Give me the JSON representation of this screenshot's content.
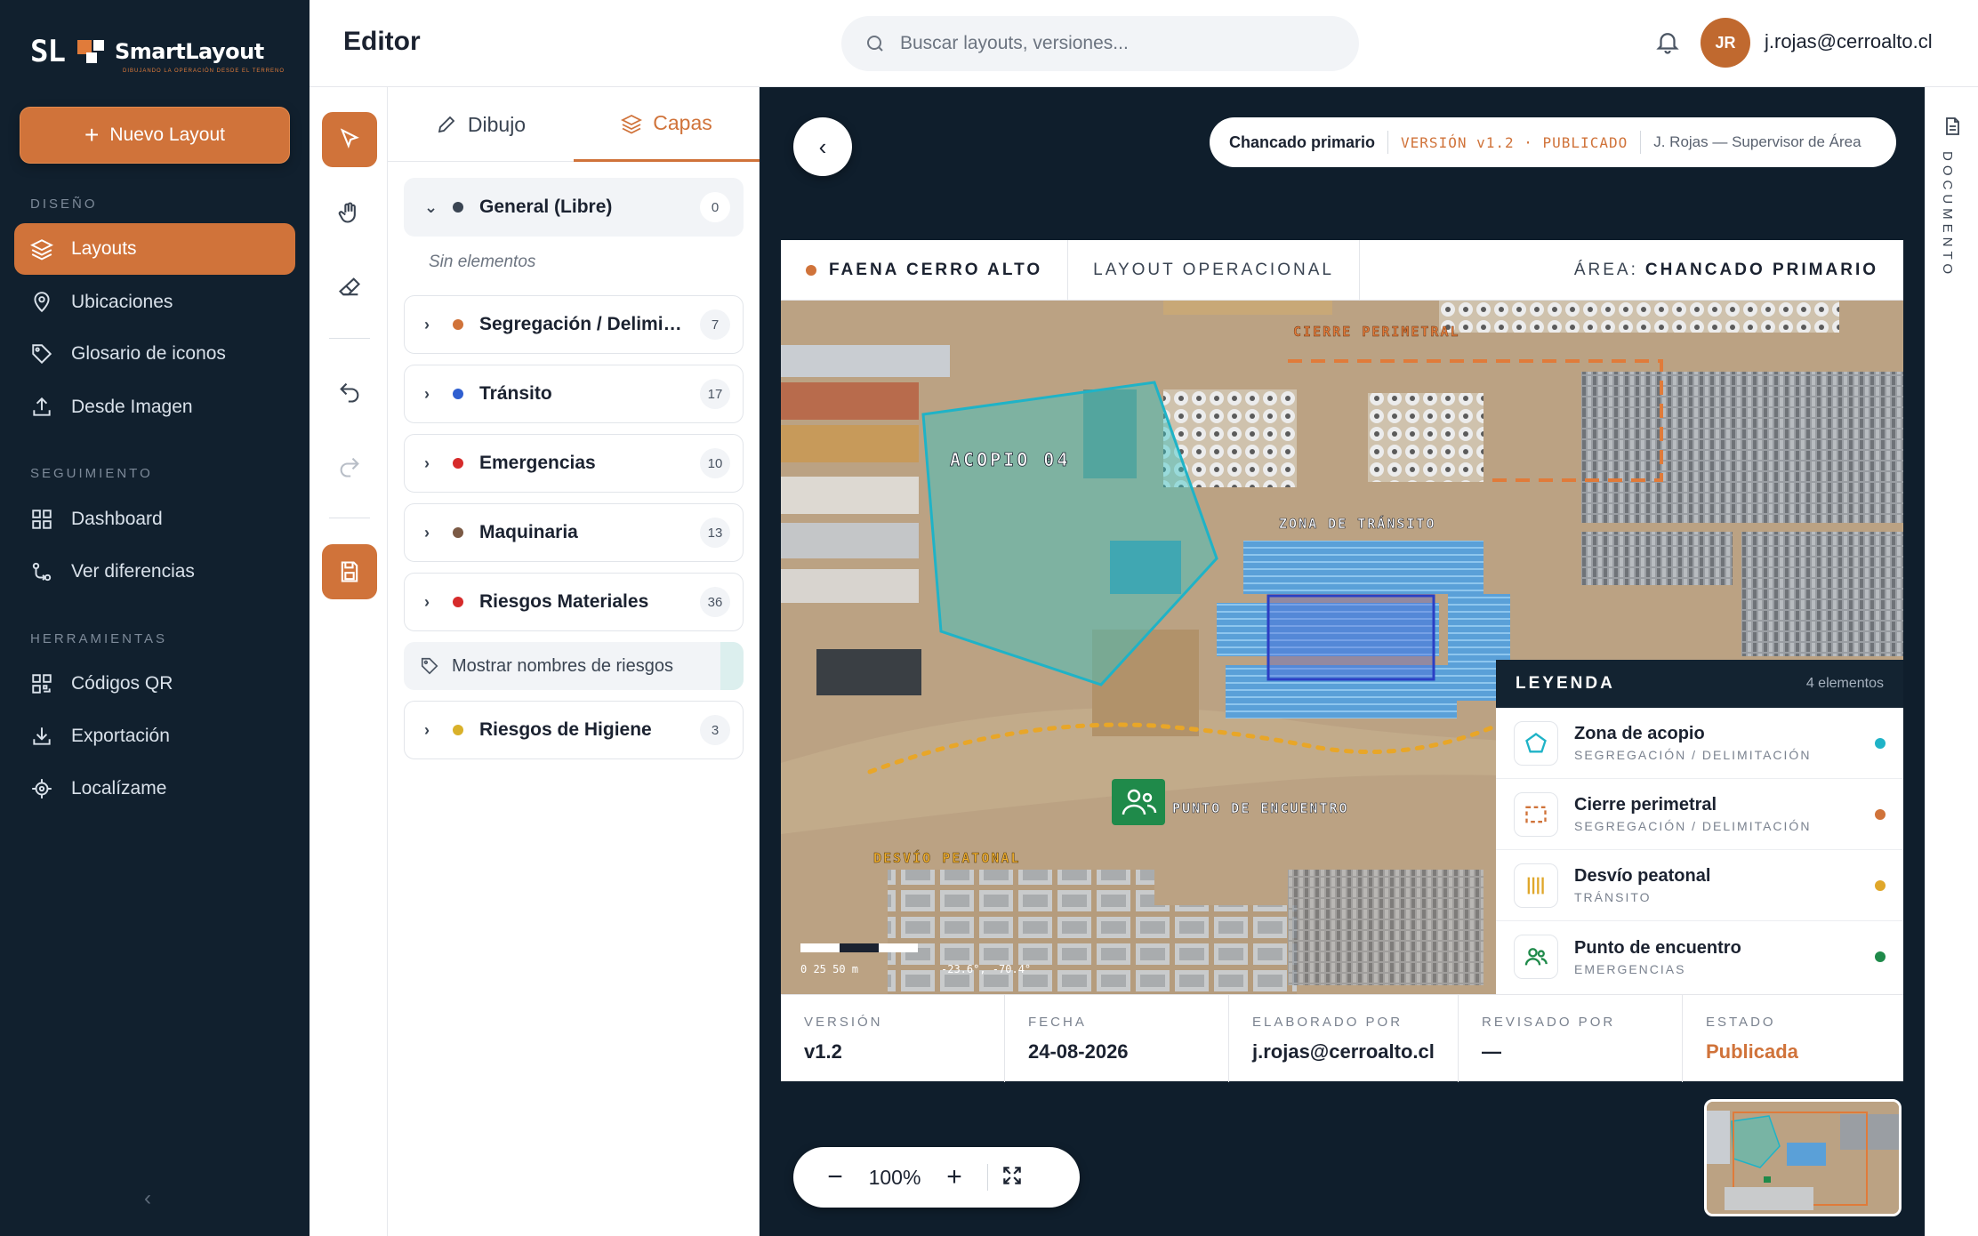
{
  "brand": {
    "mark": "SL",
    "name": "SmartLayout",
    "tagline": "DIBUJANDO LA OPERACIÓN DESDE EL TERRENO"
  },
  "sidebar": {
    "new_button": "Nuevo Layout",
    "sections": [
      {
        "title": "DISEÑO",
        "items": [
          {
            "label": "Layouts",
            "icon": "layers-icon",
            "active": true
          },
          {
            "label": "Ubicaciones",
            "icon": "map-pin-icon"
          },
          {
            "label": "Glosario de iconos",
            "icon": "tag-icon"
          },
          {
            "label": "Desde Imagen",
            "icon": "upload-icon"
          }
        ]
      },
      {
        "title": "SEGUIMIENTO",
        "items": [
          {
            "label": "Dashboard",
            "icon": "grid-icon"
          },
          {
            "label": "Ver diferencias",
            "icon": "diff-icon"
          }
        ]
      },
      {
        "title": "HERRAMIENTAS",
        "items": [
          {
            "label": "Códigos QR",
            "icon": "qr-icon"
          },
          {
            "label": "Exportación",
            "icon": "download-icon"
          },
          {
            "label": "Localízame",
            "icon": "locate-icon"
          }
        ]
      }
    ],
    "collapse": "‹"
  },
  "header": {
    "title": "Editor",
    "search_placeholder": "Buscar layouts, versiones...",
    "avatar_initials": "JR",
    "user_email": "j.rojas@cerroalto.cl"
  },
  "tools": [
    "select-tool",
    "pan-tool",
    "eraser-tool",
    "undo-tool",
    "redo-tool",
    "save-tool"
  ],
  "panel": {
    "tabs": [
      {
        "label": "Dibujo",
        "icon": "pencil-icon"
      },
      {
        "label": "Capas",
        "icon": "layers-icon",
        "active": true
      }
    ],
    "general": {
      "name": "General (Libre)",
      "count": "0",
      "color": "#3a4452"
    },
    "empty_note": "Sin elementos",
    "groups": [
      {
        "name": "Segregación / Delimitación",
        "count": "7",
        "color": "#d0733a"
      },
      {
        "name": "Tránsito",
        "count": "17",
        "color": "#2f5fd0"
      },
      {
        "name": "Emergencias",
        "count": "10",
        "color": "#d62b2b"
      },
      {
        "name": "Maquinaria",
        "count": "13",
        "color": "#7b5a45"
      },
      {
        "name": "Riesgos Materiales",
        "count": "36",
        "color": "#d62b2b"
      }
    ],
    "toggle_label": "Mostrar nombres de riesgos",
    "last_group": {
      "name": "Riesgos de Higiene",
      "count": "3",
      "color": "#d9b12a"
    }
  },
  "canvas": {
    "area_name": "Chancado primario",
    "version_status": "VERSIÓN v1.2 · PUBLICADO",
    "author_role": "J. Rojas — Supervisor de Área",
    "sheet": {
      "site": "FAENA CERRO ALTO",
      "layout_type": "LAYOUT OPERACIONAL",
      "area_label": "ÁREA:",
      "area_value": "CHANCADO PRIMARIO"
    },
    "map_labels": {
      "acopio": "ACOPIO 04",
      "zona_transito": "ZONA DE TRÁNSITO",
      "cierre": "CIERRE PERIMETRAL",
      "punto": "PUNTO DE ENCUENTRO",
      "desvio": "DESVÍO PEATONAL",
      "scale": "0  25  50 m",
      "coords": "-23.6°, -70.4°"
    },
    "legend": {
      "title": "LEYENDA",
      "count": "4 elementos",
      "items": [
        {
          "name": "Zona de acopio",
          "category": "SEGREGACIÓN / DELIMITACIÓN",
          "icon": "pentagon-icon",
          "color": "#1fb3c7"
        },
        {
          "name": "Cierre perimetral",
          "category": "SEGREGACIÓN / DELIMITACIÓN",
          "icon": "dashed-rect-icon",
          "color": "#d0733a"
        },
        {
          "name": "Desvío peatonal",
          "category": "TRÁNSITO",
          "icon": "bars-icon",
          "color": "#e0a72a"
        },
        {
          "name": "Punto de encuentro",
          "category": "EMERGENCIAS",
          "icon": "people-icon",
          "color": "#1f8a4a"
        }
      ]
    },
    "footer": [
      {
        "label": "VERSIÓN",
        "value": "v1.2"
      },
      {
        "label": "FECHA",
        "value": "24-08-2026"
      },
      {
        "label": "ELABORADO POR",
        "value": "j.rojas@cerroalto.cl"
      },
      {
        "label": "REVISADO POR",
        "value": "—"
      },
      {
        "label": "ESTADO",
        "value": "Publicada"
      }
    ],
    "zoom": "100%"
  },
  "right_rail": {
    "label": "DOCUMENTO"
  }
}
